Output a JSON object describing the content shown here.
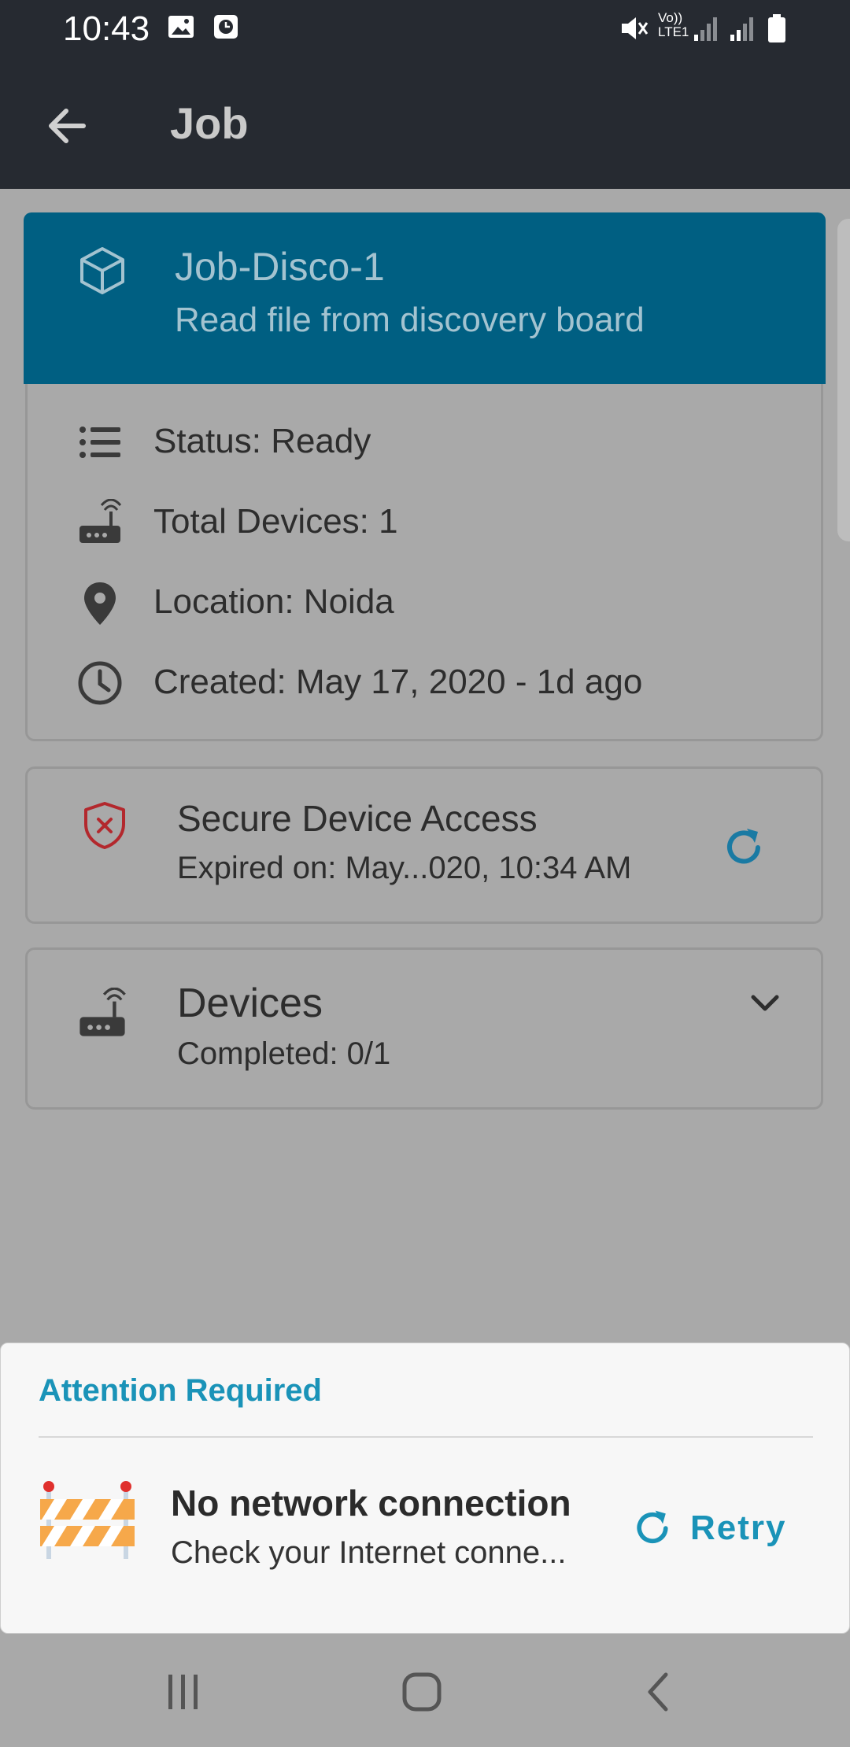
{
  "status_bar": {
    "time": "10:43",
    "icons": [
      "image-icon",
      "clock-notify-icon",
      "mute-icon",
      "volte-icon",
      "signal-icon",
      "signal-icon",
      "battery-icon"
    ],
    "volte_label": "Vo)) LTE1"
  },
  "app_bar": {
    "title": "Job",
    "back_icon": "arrow-left-icon"
  },
  "job": {
    "name": "Job-Disco-1",
    "description": "Read file from discovery board",
    "header_color": "#005f82",
    "icon": "cube-icon"
  },
  "details": [
    {
      "icon": "list-icon",
      "text": "Status: Ready"
    },
    {
      "icon": "router-icon",
      "text": "Total Devices: 1"
    },
    {
      "icon": "location-pin-icon",
      "text": "Location: Noida"
    },
    {
      "icon": "clock-icon",
      "text": "Created: May 17, 2020 - 1d ago"
    }
  ],
  "secure_access": {
    "title": "Secure Device Access",
    "subtitle": "Expired on: May...020, 10:34 AM",
    "icon": "shield-x-icon",
    "action_icon": "refresh-icon"
  },
  "devices": {
    "title": "Devices",
    "subtitle": "Completed: 0/1",
    "icon": "router-icon",
    "toggle_icon": "chevron-down-icon"
  },
  "attention_sheet": {
    "heading": "Attention Required",
    "title": "No network connection",
    "message": "Check your Internet conne...",
    "retry_label": "Retry",
    "accent_color": "#1a93b8",
    "illustration": "road-barrier-icon"
  },
  "nav_bar": {
    "buttons": [
      "recents-icon",
      "home-icon",
      "back-icon"
    ]
  }
}
